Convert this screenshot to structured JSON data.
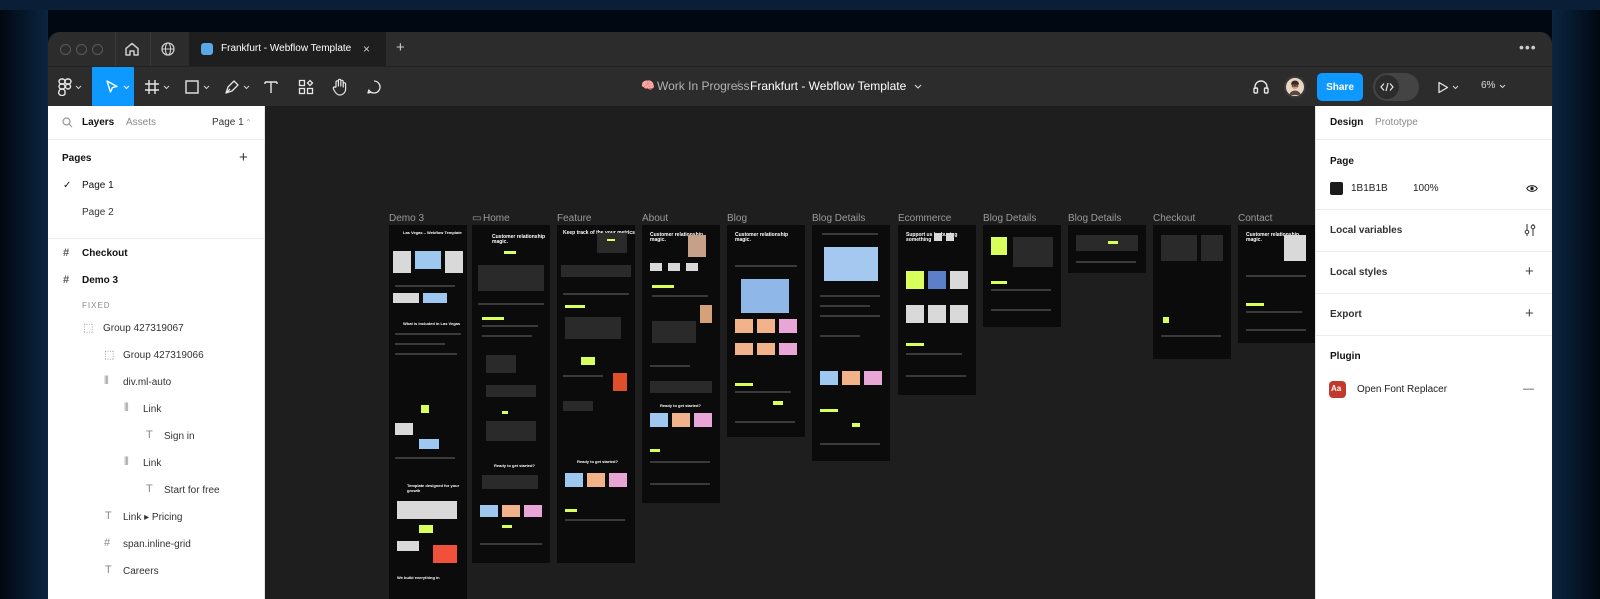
{
  "browser": {
    "tab_title": "Frankfurt - Webflow Template",
    "tab_close_icon": "×",
    "new_tab_icon": "+",
    "more_icon": "•••"
  },
  "toolbar": {
    "project_emoji": "🧠",
    "project_name": "Work In Progress",
    "separator": "/",
    "file_name": "Frankfurt - Webflow Template",
    "share_label": "Share",
    "zoom_label": "6%",
    "icons": [
      "figma-menu-icon",
      "move-tool-icon",
      "frame-tool-icon",
      "shape-tool-icon",
      "pen-tool-icon",
      "text-tool-icon",
      "components-icon",
      "hand-tool-icon",
      "comment-icon",
      "headphones-icon",
      "avatar",
      "dev-mode-icon",
      "present-icon"
    ]
  },
  "left_panel": {
    "tabs": {
      "layers": "Layers",
      "assets": "Assets",
      "page_selector": "Page 1",
      "page_selector_caret": "⌃"
    },
    "pages_heading": "Pages",
    "add_page_icon": "+",
    "check_icon": "✓",
    "pages": [
      "Page 1",
      "Page 2"
    ],
    "layers": [
      {
        "label": "Checkout",
        "icon": "frame-icon",
        "glyph": "#",
        "bold": true
      },
      {
        "label": "Demo 3",
        "icon": "frame-icon",
        "glyph": "#",
        "bold": true
      },
      {
        "label": "FIXED",
        "section": true
      },
      {
        "label": "Group 427319067",
        "icon": "group-icon",
        "glyph": "⬚"
      },
      {
        "label": "Group 427319066",
        "icon": "group-icon",
        "glyph": "⬚"
      },
      {
        "label": "div.ml-auto",
        "icon": "autolayout-icon",
        "glyph": "⦀"
      },
      {
        "label": "Link",
        "icon": "autolayout-icon",
        "glyph": "⦀"
      },
      {
        "label": "Sign in",
        "icon": "text-layer-icon",
        "glyph": "T"
      },
      {
        "label": "Link",
        "icon": "autolayout-icon",
        "glyph": "⦀"
      },
      {
        "label": "Start for free",
        "icon": "text-layer-icon",
        "glyph": "T"
      },
      {
        "label": "Link ▸ Pricing",
        "icon": "text-layer-icon",
        "glyph": "T"
      },
      {
        "label": "span.inline-grid",
        "icon": "frame-icon",
        "glyph": "#"
      },
      {
        "label": "Careers",
        "icon": "text-layer-icon",
        "glyph": "T"
      }
    ]
  },
  "canvas": {
    "home_label_icon": "▭",
    "frames": [
      {
        "label": "Demo 3",
        "headline": "Las Vegas – Webflow Template"
      },
      {
        "label": "Home",
        "headline": "Customer relationship magic."
      },
      {
        "label": "Feature",
        "headline": "Keep track of the your metrics"
      },
      {
        "label": "About",
        "headline": "Customer relationship magic."
      },
      {
        "label": "Blog",
        "headline": "Customer relationship magic."
      },
      {
        "label": "Blog Details",
        "headline": ""
      },
      {
        "label": "Ecommerce",
        "headline": "Support us by buying something"
      },
      {
        "label": "Blog Details",
        "headline": ""
      },
      {
        "label": "Blog Details",
        "headline": ""
      },
      {
        "label": "Checkout",
        "headline": ""
      },
      {
        "label": "Contact",
        "headline": "Customer relationship magic."
      }
    ]
  },
  "right_panel": {
    "tabs": {
      "design": "Design",
      "prototype": "Prototype"
    },
    "page_heading": "Page",
    "page_color": "1B1B1B",
    "page_opacity": "100%",
    "local_variables": "Local variables",
    "local_styles": "Local styles",
    "export": "Export",
    "plugin_heading": "Plugin",
    "plugin_name": "Open Font Replacer",
    "plus_icon": "+",
    "minus_icon": "—",
    "plugin_icon_text": "Aa"
  },
  "colors": {
    "accent": "#0d99ff",
    "canvas_bg": "#1e1e1e",
    "chrome_bg": "#2c2c2c",
    "lime": "#d8ff5c"
  }
}
